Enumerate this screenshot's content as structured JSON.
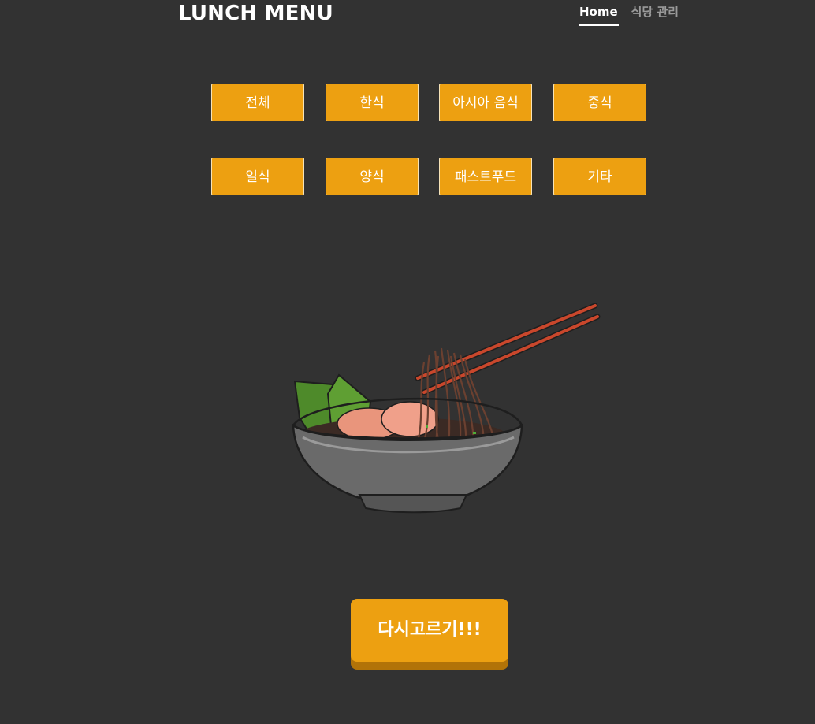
{
  "header": {
    "brand": "LUNCH MENU",
    "nav": [
      {
        "label": "Home",
        "active": true
      },
      {
        "label": "식당 관리",
        "active": false
      }
    ]
  },
  "categories": [
    {
      "label": "전체"
    },
    {
      "label": "한식"
    },
    {
      "label": "아시아 음식"
    },
    {
      "label": "중식"
    },
    {
      "label": "일식"
    },
    {
      "label": "양식"
    },
    {
      "label": "패스트푸드"
    },
    {
      "label": "기타"
    }
  ],
  "result": {
    "image_icon": "noodle-bowl-illustration"
  },
  "retry_button": {
    "label": "다시고르기!!!"
  },
  "colors": {
    "background": "#323232",
    "accent": "#eda011",
    "accent_shadow": "#b27308",
    "nav_active": "#ffffff",
    "nav_inactive": "#9a9a9a"
  }
}
